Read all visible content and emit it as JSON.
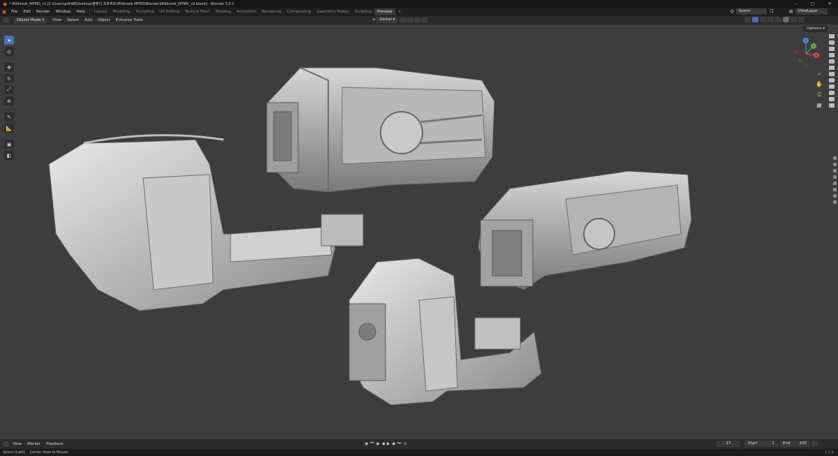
{
  "window": {
    "title": "* Millbrook_MFMD_v2 [C:\\Users\\pdh98\\Desktop\\블렌더 프로젝트\\Millbrook MFMD\\Blender\\Millbrook_MFMD_v2.blend] - Blender 5.0.1",
    "minimize": "–",
    "maximize": "▢",
    "close": "✕"
  },
  "menu": {
    "items": [
      "File",
      "Edit",
      "Render",
      "Window",
      "Help"
    ],
    "workspaces": [
      "Layout",
      "Modeling",
      "Sculpting",
      "UV Editing",
      "Texture Paint",
      "Shading",
      "Animation",
      "Rendering",
      "Compositing",
      "Geometry Nodes",
      "Scripting",
      "Preview"
    ],
    "active_workspace": "Preview",
    "add_tab": "+",
    "scene": "Scene",
    "view_layer": "ViewLayer"
  },
  "header": {
    "mode": "Object Mode",
    "menus": [
      "View",
      "Select",
      "Add",
      "Object",
      "Enfusion Tools"
    ],
    "transform_orientation": "Global",
    "options": "Options"
  },
  "timeline": {
    "menus": [
      "View",
      "Marker",
      "Playback"
    ],
    "current_frame": "17",
    "start_label": "Start",
    "start_value": "1",
    "end_label": "End",
    "end_value": "250"
  },
  "status": {
    "left1": "Select (LatD)",
    "left2": "Center View to Mouse",
    "version": "5.0.1"
  },
  "icons": {
    "tools": [
      "select-box-icon",
      "cursor-icon",
      "move-icon",
      "rotate-icon",
      "scale-icon",
      "transform-icon",
      "annotate-icon",
      "measure-icon",
      "add-cube-icon",
      "extrude-icon"
    ],
    "gizmo_axes": {
      "x": "X",
      "y": "Y",
      "z": "Z"
    }
  },
  "colors": {
    "accent": "#4772b3",
    "viewport_bg": "#3d3d3d",
    "axis_x": "#e3454f",
    "axis_y": "#6ca832",
    "axis_z": "#4d8ee0"
  }
}
